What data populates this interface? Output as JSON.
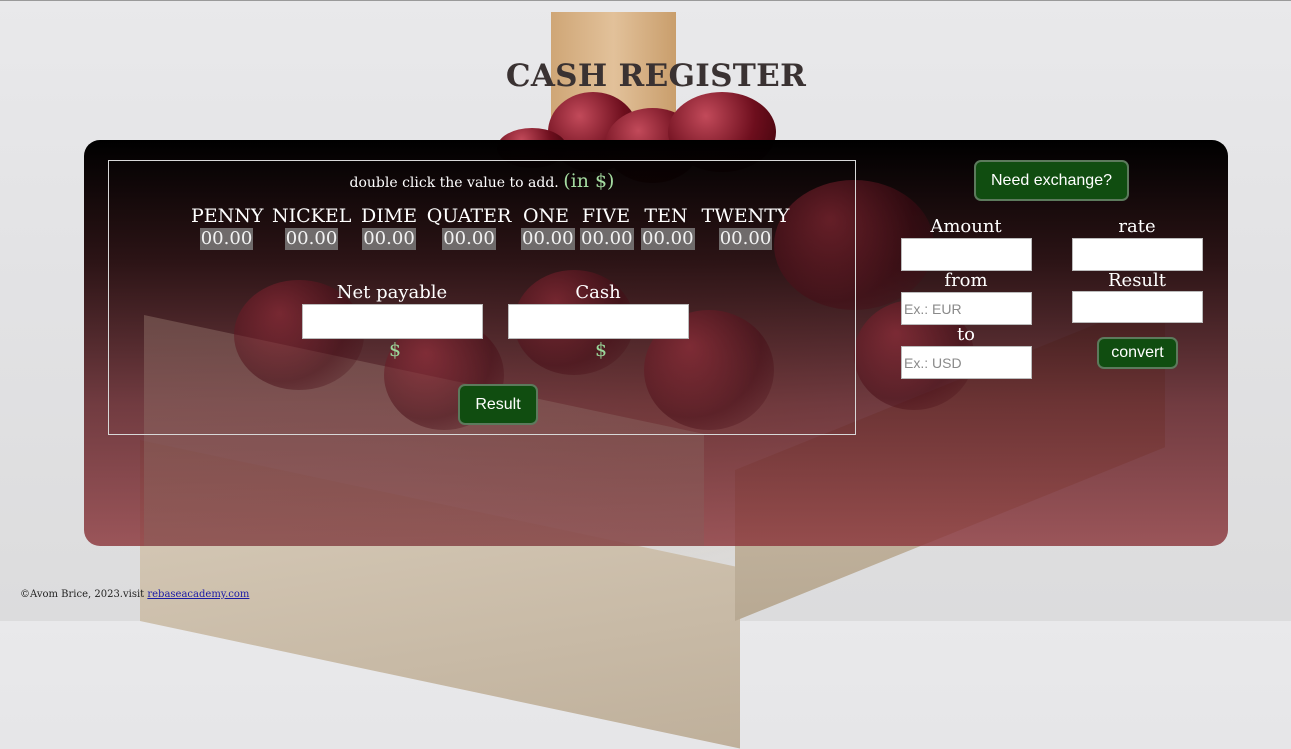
{
  "page": {
    "title": "CASH REGISTER"
  },
  "register": {
    "hint_text": "double click the value to add.",
    "hint_unit": "(in $)",
    "denominations": [
      {
        "name": "PENNY",
        "value": "00.00"
      },
      {
        "name": "NICKEL",
        "value": "00.00"
      },
      {
        "name": "DIME",
        "value": "00.00"
      },
      {
        "name": "QUATER",
        "value": "00.00"
      },
      {
        "name": "ONE",
        "value": "00.00"
      },
      {
        "name": "FIVE",
        "value": "00.00"
      },
      {
        "name": "TEN",
        "value": "00.00"
      },
      {
        "name": "TWENTY",
        "value": "00.00"
      }
    ],
    "net_payable_label": "Net payable",
    "net_payable_value": "",
    "cash_label": "Cash",
    "cash_value": "",
    "currency_symbol": "$",
    "result_button": "Result"
  },
  "exchange": {
    "toggle_button": "Need exchange?",
    "amount_label": "Amount",
    "amount_value": "",
    "rate_label": "rate",
    "rate_value": "",
    "from_label": "from",
    "from_placeholder": "Ex.: EUR",
    "result_label": "Result",
    "result_value": "",
    "to_label": "to",
    "to_placeholder": "Ex.: USD",
    "convert_button": "convert"
  },
  "footer": {
    "text": "©Avom Brice, 2023.visit ",
    "link_text": "rebaseacademy.com"
  },
  "colors": {
    "button_bg": "#104d10",
    "accent_green": "#9ad79a",
    "value_bg": "#6f6b6b",
    "title": "#3a3232"
  }
}
